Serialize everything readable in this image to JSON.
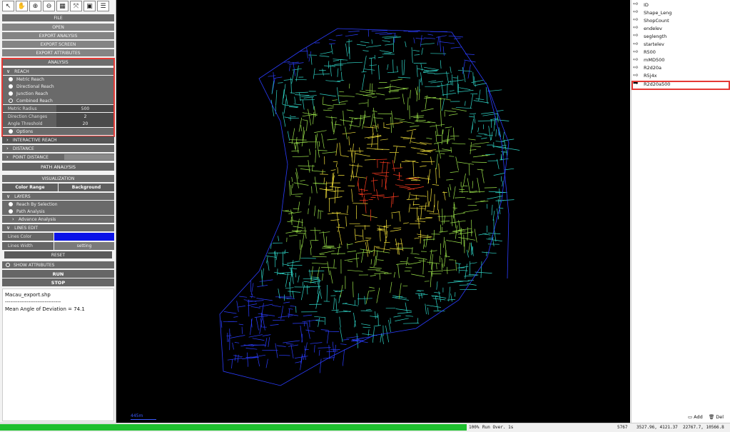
{
  "toolbar": {
    "icons": [
      "select-arrow-icon",
      "hand-pan-icon",
      "zoom-in-icon",
      "zoom-out-icon",
      "grid-icon",
      "fit-extent-icon",
      "layer-icon",
      "list-icon"
    ],
    "glyphs": [
      "↖",
      "✋",
      "⊕",
      "⊖",
      "▦",
      "⤧",
      "▣",
      "☰"
    ]
  },
  "menu": {
    "file": "FILE",
    "open": "OPEN",
    "export_analysis": "EXPORT ANALYSIS",
    "export_screen": "EXPORT SCREEN",
    "export_attributes": "EXPORT ATTRIBUTES",
    "analysis": "ANALYSIS"
  },
  "reach": {
    "header": "REACH",
    "options": [
      "Metric Reach",
      "Directional Reach",
      "Junction Reach",
      "Combined Reach"
    ],
    "params": [
      {
        "label": "Metric Radius",
        "value": "500"
      },
      {
        "label": "Direction Changes",
        "value": "2"
      },
      {
        "label": "Angle Threshold",
        "value": "20"
      }
    ],
    "options_label": "Options"
  },
  "sections": {
    "interactive_reach": "INTERACTIVE REACH",
    "distance": "DISTANCE",
    "point_distance": "POINT DISTANCE",
    "path_analysis": "PATH ANALYSIS",
    "visualization": "VISUALIZATION",
    "color_range": "Color Range",
    "background": "Background",
    "layers": "LAYERS",
    "reach_by_selection": "Reach By Selection",
    "path_analysis_item": "Path Analysis",
    "advance_analysis": "Advance Analysis",
    "lines_edit": "LINES EDIT",
    "lines_color": "Lines Color",
    "lines_color_value": "#0a12e8",
    "lines_width": "Lines Width",
    "setting": "setting",
    "reset": "RESET",
    "show_attributes": "SHOW ATTRIBUTES",
    "run": "RUN",
    "stop": "STOP"
  },
  "output": {
    "file": "Macau_export.shp",
    "separator": "-------------------------------",
    "result": "Mean Angle of Deviation = 74.1"
  },
  "map": {
    "scale_label": "445m"
  },
  "attributes": {
    "items": [
      "ID",
      "Shape_Leng",
      "ShopCount",
      "endelev",
      "seglength",
      "startelev",
      "R500",
      "mMD500",
      "R2d20a",
      "R5j4x",
      "R2d20a500"
    ],
    "selected_index": 10,
    "add": "Add",
    "del": "Del"
  },
  "status": {
    "progress": "100%",
    "message": "Run Over. 1s",
    "count": "5767",
    "coord1": "3527.96, 4121.37",
    "coord2": "22767.7, 10566.8",
    "progress_fraction": 1.0
  }
}
